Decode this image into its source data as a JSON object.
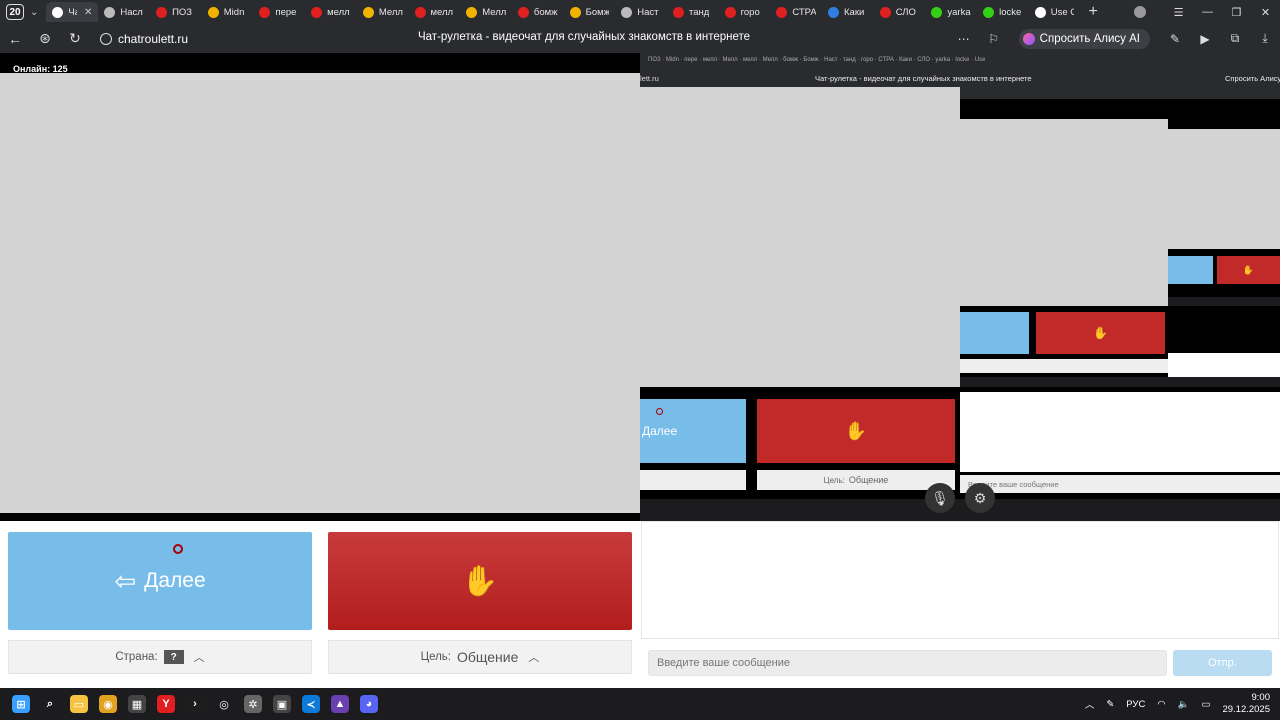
{
  "browser": {
    "tab_count": "20",
    "tabs": [
      {
        "label": "Ча",
        "icon": "chatroulette-icon",
        "color": "#ffffff",
        "active": true
      },
      {
        "label": "Насл",
        "icon": "gear-icon",
        "color": "#bbbbbb"
      },
      {
        "label": "ПОЗ",
        "icon": "yandex-icon",
        "color": "#e02020"
      },
      {
        "label": "Midn",
        "icon": "flag-icon",
        "color": "#f2b200"
      },
      {
        "label": "пере",
        "icon": "yandex-icon",
        "color": "#e02020"
      },
      {
        "label": "мелл",
        "icon": "yandex-icon",
        "color": "#e02020"
      },
      {
        "label": "Мелл",
        "icon": "flag-icon",
        "color": "#f2b200"
      },
      {
        "label": "мелл",
        "icon": "yandex-icon",
        "color": "#e02020"
      },
      {
        "label": "Мелл",
        "icon": "flag-icon",
        "color": "#f2b200"
      },
      {
        "label": "бомж",
        "icon": "yandex-icon",
        "color": "#e02020"
      },
      {
        "label": "Бомж",
        "icon": "flag-icon",
        "color": "#f2b200"
      },
      {
        "label": "Наст",
        "icon": "gear-icon",
        "color": "#bbbbbb"
      },
      {
        "label": "танд",
        "icon": "yandex-icon",
        "color": "#e02020"
      },
      {
        "label": "горо",
        "icon": "yandex-icon",
        "color": "#e02020"
      },
      {
        "label": "СТРА",
        "icon": "yandex-icon",
        "color": "#e02020"
      },
      {
        "label": "Каки",
        "icon": "question-icon",
        "color": "#2f7fe0"
      },
      {
        "label": "СЛО",
        "icon": "yandex-icon",
        "color": "#e02020"
      },
      {
        "label": "yarka",
        "icon": "k-icon",
        "color": "#33d017"
      },
      {
        "label": "locke",
        "icon": "k-icon",
        "color": "#33d017"
      },
      {
        "label": "Use C",
        "icon": "gmail-icon",
        "color": "#ffffff"
      }
    ],
    "url": "chatroulett.ru",
    "page_title": "Чат-рулетка - видеочат для случайных знакомств в интернете",
    "alice_label": "Спросить Алису AI"
  },
  "page": {
    "online_label": "Онлайн: 125",
    "next_button": "Далее",
    "country_label": "Страна:",
    "country_value": "?",
    "goal_label": "Цель:",
    "goal_value": "Общение",
    "message_placeholder": "Введите ваше сообщение",
    "send_label": "Отпр."
  },
  "mirror": {
    "page_title": "Чат-рулетка - видеочат для случайных знакомств в интернете",
    "url_fragment": "lett.ru",
    "alice_label": "Спросить Алису",
    "next_button": "Далее",
    "goal_label": "Цель:",
    "goal_value": "Общение",
    "message_placeholder": "Введите ваше сообщение"
  },
  "taskbar": {
    "apps": [
      {
        "name": "windows-start-icon",
        "color": "#3aa0ff",
        "glyph": "⊞"
      },
      {
        "name": "search-icon",
        "color": "#1c1c1f",
        "glyph": "⌕"
      },
      {
        "name": "file-explorer-icon",
        "color": "#f5c242",
        "glyph": "▭"
      },
      {
        "name": "chrome-icon",
        "color": "#e0a020",
        "glyph": "◉"
      },
      {
        "name": "store-icon",
        "color": "#444444",
        "glyph": "▦"
      },
      {
        "name": "yandex-browser-icon",
        "color": "#e02020",
        "glyph": "Y"
      },
      {
        "name": "terminal-icon",
        "color": "#1d1d1d",
        "glyph": "›"
      },
      {
        "name": "github-desktop-icon",
        "color": "#1c1c1f",
        "glyph": "◎"
      },
      {
        "name": "settings-icon",
        "color": "#666666",
        "glyph": "✲"
      },
      {
        "name": "app-icon",
        "color": "#444444",
        "glyph": "▣"
      },
      {
        "name": "vscode-icon",
        "color": "#0e7ad8",
        "glyph": "≺"
      },
      {
        "name": "obs-icon",
        "color": "#6a3fb0",
        "glyph": "▲"
      },
      {
        "name": "discord-icon",
        "color": "#5865f2",
        "glyph": "◕"
      }
    ],
    "language": "РУС",
    "time": "9:00",
    "date": "29.12.2025"
  }
}
